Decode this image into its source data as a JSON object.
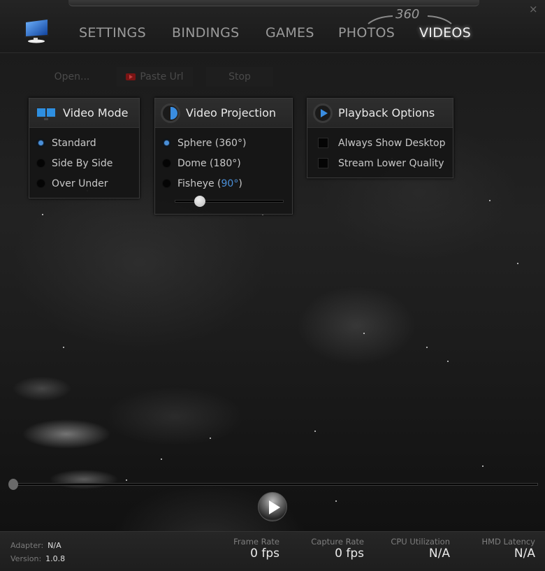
{
  "header": {
    "nav": [
      {
        "label": "SETTINGS",
        "active": false
      },
      {
        "label": "BINDINGS",
        "active": false
      },
      {
        "label": "GAMES",
        "active": false
      },
      {
        "label": "PHOTOS",
        "active": false
      },
      {
        "label": "VIDEOS",
        "active": true
      }
    ],
    "badge_360": "360",
    "close_glyph": "×"
  },
  "toolbar": {
    "open_label": "Open...",
    "paste_url_label": "Paste Url",
    "stop_label": "Stop"
  },
  "video_mode": {
    "title": "Video Mode",
    "options": [
      {
        "label": "Standard",
        "selected": true
      },
      {
        "label": "Side By Side",
        "selected": false
      },
      {
        "label": "Over Under",
        "selected": false
      }
    ]
  },
  "video_projection": {
    "title": "Video Projection",
    "options": [
      {
        "label": "Sphere (360°)",
        "selected": true
      },
      {
        "label": "Dome (180°)",
        "selected": false
      }
    ],
    "fisheye": {
      "label_prefix": "Fisheye (",
      "value": "90°",
      "label_suffix": ")",
      "selected": false
    },
    "fisheye_slider_fraction": 0.2
  },
  "playback_options": {
    "title": "Playback Options",
    "options": [
      {
        "label": "Always Show Desktop",
        "checked": false
      },
      {
        "label": "Stream Lower Quality",
        "checked": false
      }
    ]
  },
  "player": {
    "seek_fraction": 0.0
  },
  "status": {
    "adapter_label": "Adapter:",
    "adapter_value": "N/A",
    "version_label": "Version:",
    "version_value": "1.0.8",
    "stats": [
      {
        "label": "Frame Rate",
        "value": "0 fps"
      },
      {
        "label": "Capture Rate",
        "value": "0 fps"
      },
      {
        "label": "CPU Utilization",
        "value": "N/A"
      },
      {
        "label": "HMD Latency",
        "value": "N/A"
      }
    ]
  },
  "colors": {
    "accent": "#4a8fd8",
    "background": "#1a1a1a"
  }
}
